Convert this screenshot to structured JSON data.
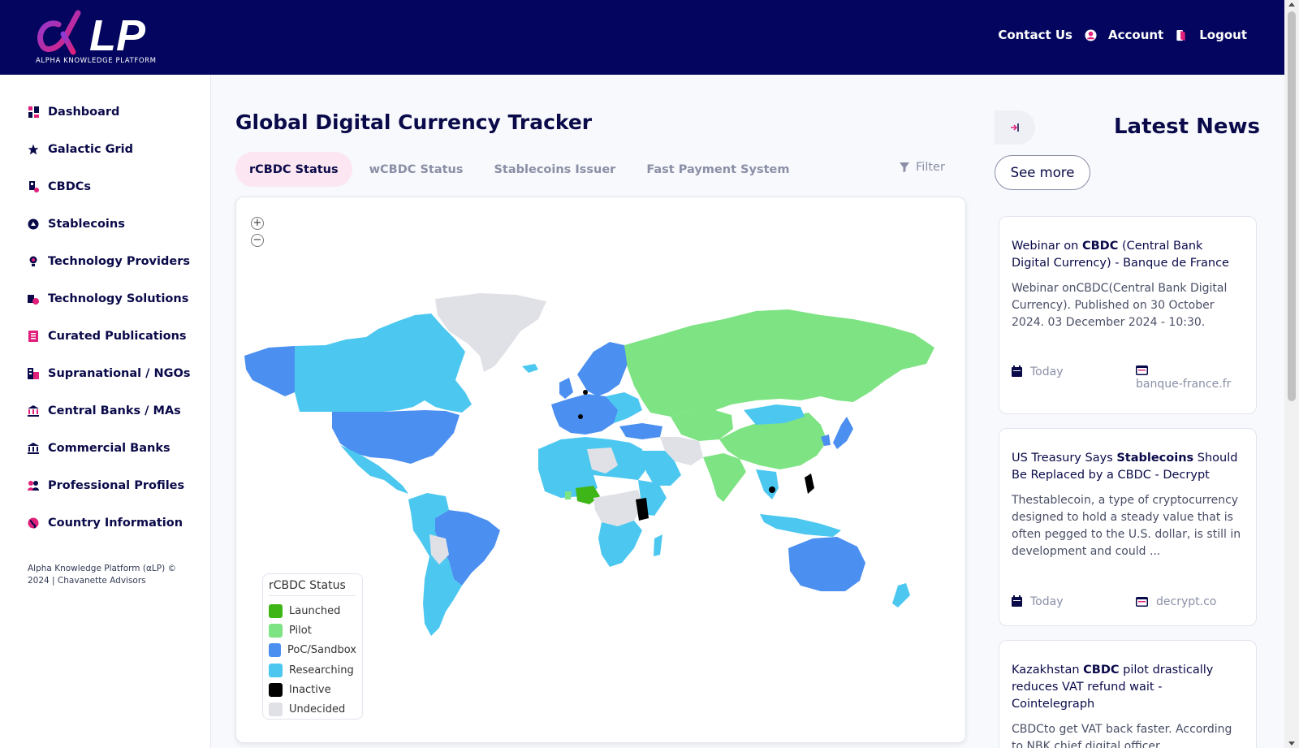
{
  "brand": {
    "logo_text": "LP",
    "logo_subtitle": "ALPHA KNOWLEDGE PLATFORM"
  },
  "topnav": {
    "contact": "Contact Us",
    "account": "Account",
    "logout": "Logout"
  },
  "sidebar": {
    "items": [
      {
        "label": "Dashboard",
        "icon": "dashboard-icon"
      },
      {
        "label": "Galactic Grid",
        "icon": "star-icon"
      },
      {
        "label": "CBDCs",
        "icon": "cbdc-icon"
      },
      {
        "label": "Stablecoins",
        "icon": "stablecoin-icon"
      },
      {
        "label": "Technology Providers",
        "icon": "lightbulb-icon"
      },
      {
        "label": "Technology Solutions",
        "icon": "solutions-icon"
      },
      {
        "label": "Curated Publications",
        "icon": "publication-icon"
      },
      {
        "label": "Supranational / NGOs",
        "icon": "building-icon"
      },
      {
        "label": "Central Banks / MAs",
        "icon": "bank-icon"
      },
      {
        "label": "Commercial Banks",
        "icon": "bank-icon"
      },
      {
        "label": "Professional Profiles",
        "icon": "people-icon"
      },
      {
        "label": "Country Information",
        "icon": "globe-icon"
      }
    ],
    "copyright": "Alpha Knowledge Platform (αLP) © 2024 | Chavanette Advisors"
  },
  "main": {
    "title": "Global Digital Currency Tracker",
    "tabs": [
      {
        "label": "rCBDC Status",
        "active": true
      },
      {
        "label": "wCBDC Status",
        "active": false
      },
      {
        "label": "Stablecoins Issuer",
        "active": false
      },
      {
        "label": "Fast Payment System",
        "active": false
      }
    ],
    "filter_label": "Filter",
    "zoom_in": "+",
    "zoom_out": "−",
    "legend": {
      "title": "rCBDC Status",
      "items": [
        {
          "label": "Launched",
          "color": "#3fb618"
        },
        {
          "label": "Pilot",
          "color": "#7ee383"
        },
        {
          "label": "PoC/Sandbox",
          "color": "#4b8ff0"
        },
        {
          "label": "Researching",
          "color": "#4cc8f0"
        },
        {
          "label": "Inactive",
          "color": "#000000"
        },
        {
          "label": "Undecided",
          "color": "#e0e1e6"
        }
      ]
    }
  },
  "news": {
    "title": "Latest News",
    "see_more": "See more",
    "items": [
      {
        "headline_pre": "Webinar on ",
        "headline_bold": "CBDC",
        "headline_post": " (Central Bank Digital Currency) - Banque de France",
        "body": "Webinar onCBDC(Central Bank Digital Currency). Published on 30 October 2024. 03 December 2024 - 10:30.",
        "date": "Today",
        "source": "banque-france.fr"
      },
      {
        "headline_pre": "US Treasury Says ",
        "headline_bold": "Stablecoins",
        "headline_post": " Should Be Replaced by a CBDC - Decrypt",
        "body": "Thestablecoin, a type of cryptocurrency designed to hold a steady value that is often pegged to the U.S. dollar, is still in development and could ...",
        "date": "Today",
        "source": "decrypt.co"
      },
      {
        "headline_pre": "Kazakhstan ",
        "headline_bold": "CBDC",
        "headline_post": " pilot drastically reduces VAT refund wait - Cointelegraph",
        "body": "CBDCto get VAT back faster. According to NBK chief digital officer"
      }
    ]
  },
  "colors": {
    "header_bg": "#03055f",
    "accent_pink": "#e0207a",
    "active_tab_bg": "#fce6f1"
  }
}
